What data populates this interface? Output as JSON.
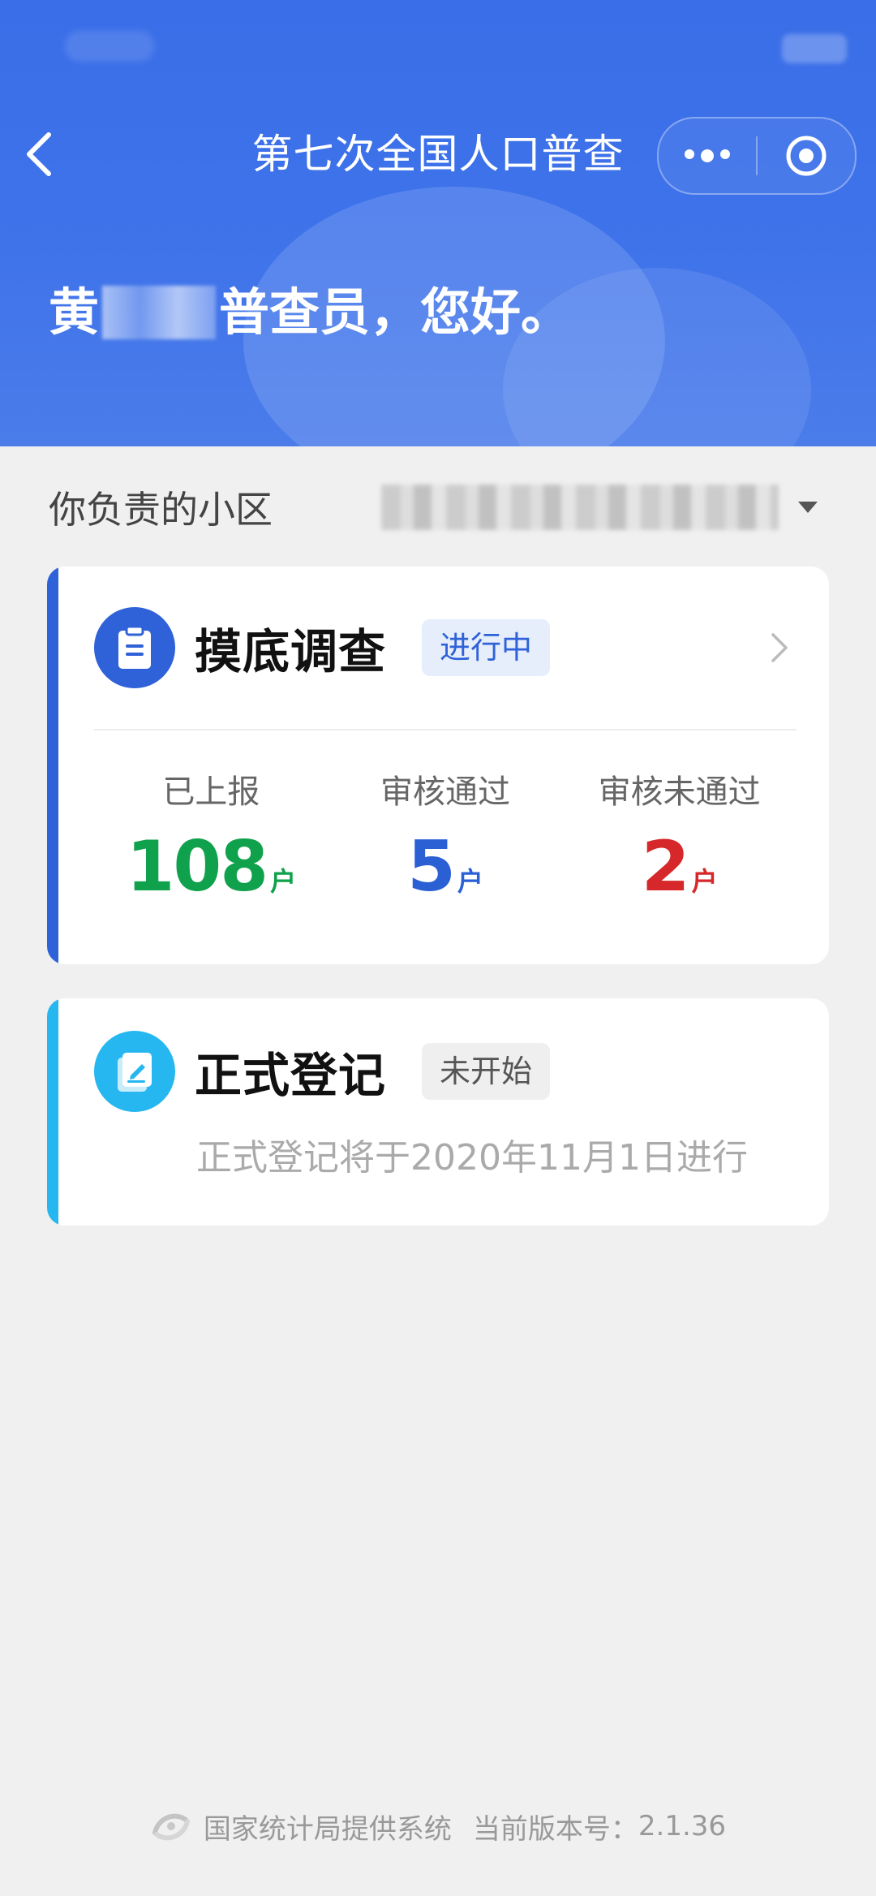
{
  "header": {
    "title": "第七次全国人口普查",
    "greeting_prefix": "黄",
    "greeting_suffix": "普查员，您好。",
    "colors": {
      "primary": "#3a6ee8"
    }
  },
  "community": {
    "label": "你负责的小区",
    "value": ""
  },
  "cards": [
    {
      "title": "摸底调查",
      "status": "进行中",
      "icon": "clipboard-icon",
      "stripe_color": "#2f62d8",
      "stats": [
        {
          "label": "已上报",
          "value": "108",
          "unit": "户",
          "color": "#0fa14b"
        },
        {
          "label": "审核通过",
          "value": "5",
          "unit": "户",
          "color": "#2b5fd4"
        },
        {
          "label": "审核未通过",
          "value": "2",
          "unit": "户",
          "color": "#d6282a"
        }
      ]
    },
    {
      "title": "正式登记",
      "status": "未开始",
      "icon": "edit-document-icon",
      "stripe_color": "#27b7f0",
      "subtitle": "正式登记将于2020年11月1日进行"
    }
  ],
  "footer": {
    "provider": "国家统计局提供系统",
    "version_label": "当前版本号：",
    "version": "2.1.36"
  }
}
